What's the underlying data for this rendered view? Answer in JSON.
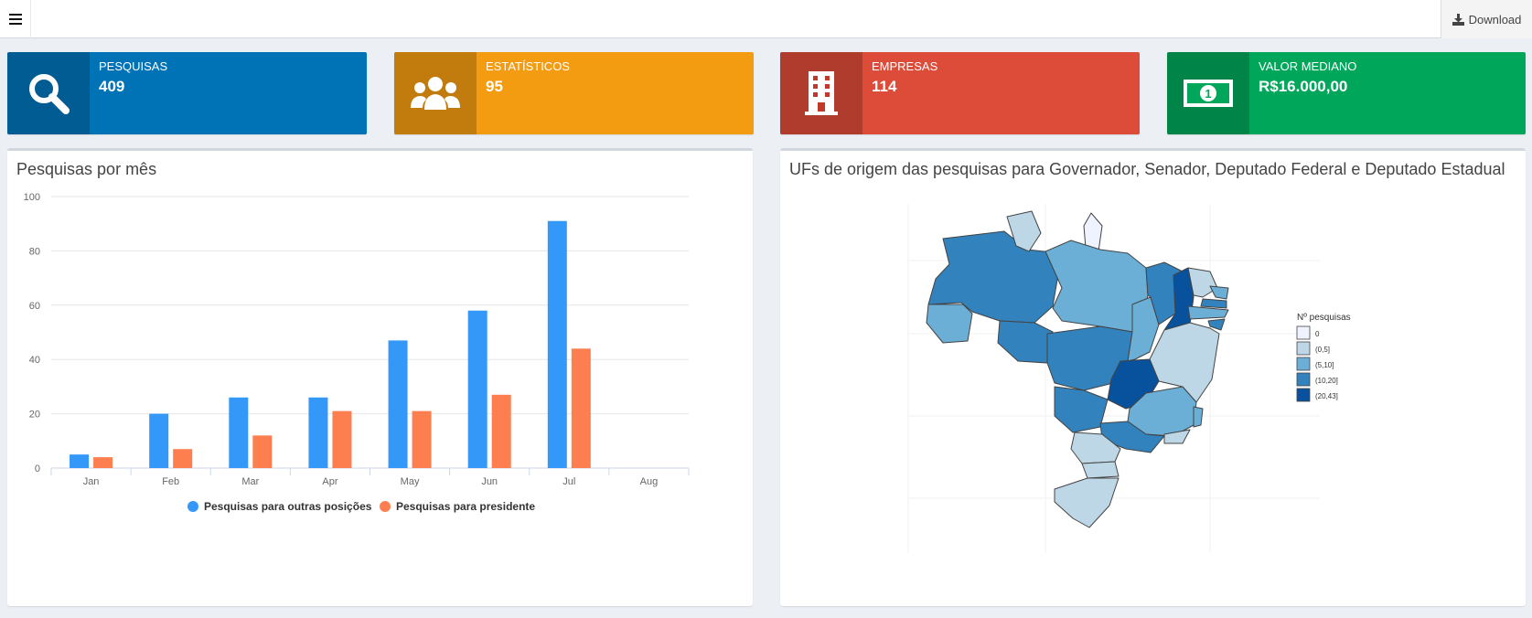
{
  "header": {
    "download_label": "Download"
  },
  "info_boxes": [
    {
      "label": "PESQUISAS",
      "value": "409",
      "color": "#0073b7",
      "icon": "search-icon"
    },
    {
      "label": "ESTATÍSTICOS",
      "value": "95",
      "color": "#f39c12",
      "icon": "users-icon"
    },
    {
      "label": "EMPRESAS",
      "value": "114",
      "color": "#dd4b39",
      "icon": "building-icon"
    },
    {
      "label": "VALOR MEDIANO",
      "value": "R$16.000,00",
      "color": "#00a65a",
      "icon": "money-icon"
    }
  ],
  "bar_panel": {
    "title": "Pesquisas por mês"
  },
  "map_panel": {
    "title": "UFs de origem das pesquisas para Governador, Senador, Deputado Federal e Deputado Estadual",
    "legend_title": "Nº pesquisas",
    "legend": [
      {
        "label": "0",
        "color": "#eff3ff"
      },
      {
        "label": "(0,5]",
        "color": "#bdd7e7"
      },
      {
        "label": "(5,10]",
        "color": "#6baed6"
      },
      {
        "label": "(10,20]",
        "color": "#3182bd"
      },
      {
        "label": "(20,43]",
        "color": "#08519c"
      }
    ]
  },
  "chart_data": {
    "type": "bar",
    "categories": [
      "Jan",
      "Feb",
      "Mar",
      "Apr",
      "May",
      "Jun",
      "Jul",
      "Aug"
    ],
    "series": [
      {
        "name": "Pesquisas para outras posições",
        "color": "#3498f8",
        "values": [
          5,
          20,
          26,
          26,
          47,
          58,
          91,
          null
        ]
      },
      {
        "name": "Pesquisas para presidente",
        "color": "#fd7f50",
        "values": [
          4,
          7,
          12,
          21,
          21,
          27,
          44,
          null
        ]
      }
    ],
    "ylim": [
      0,
      100
    ],
    "yticks": [
      0,
      20,
      40,
      60,
      80,
      100
    ],
    "grid": true,
    "legend_position": "bottom"
  }
}
